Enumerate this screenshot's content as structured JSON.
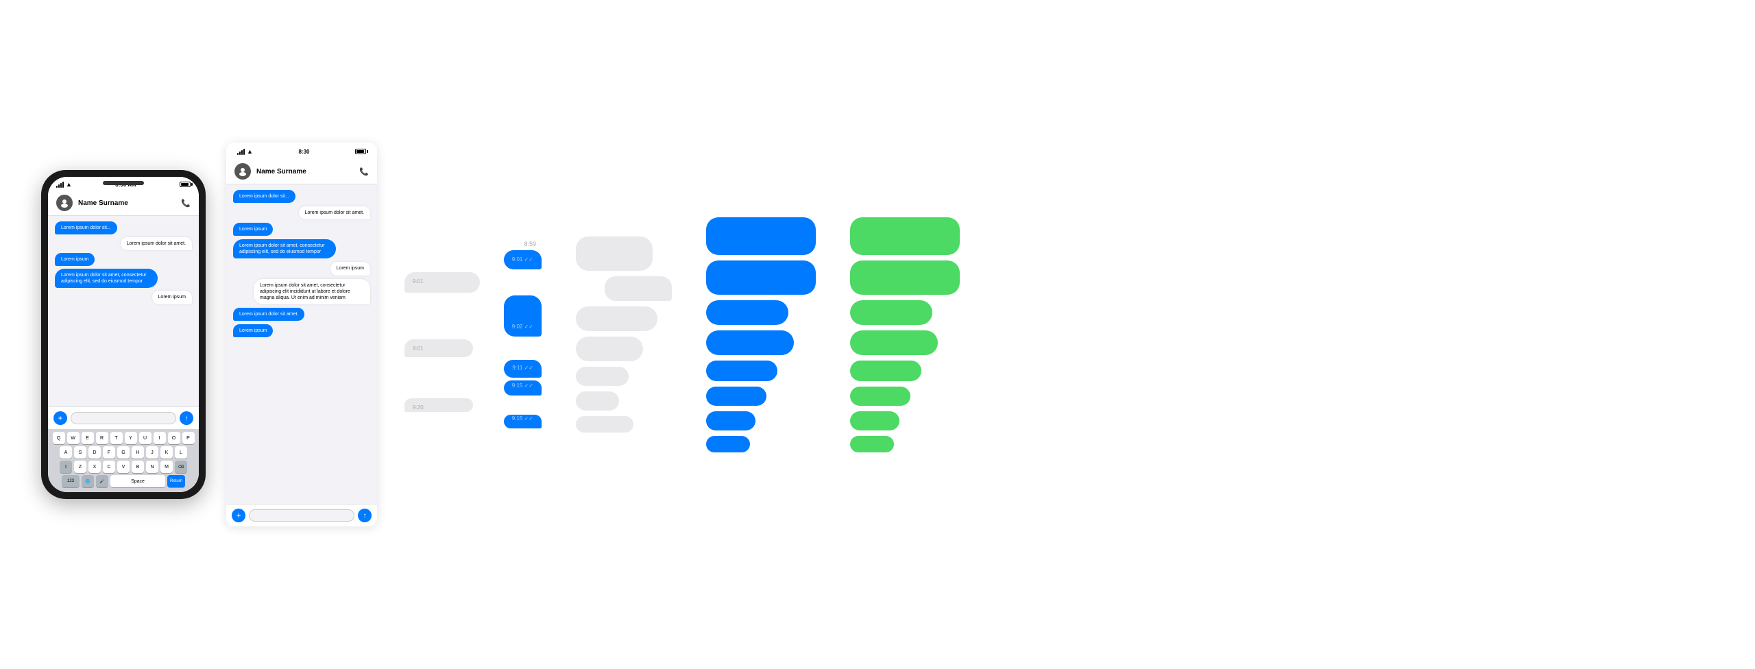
{
  "phone1": {
    "status_time": "8:30 AM",
    "contact_name": "Name Surname",
    "messages": [
      {
        "type": "sent",
        "text": "Lorem ipsum dolor sit..."
      },
      {
        "type": "received",
        "text": "Lorem ipsum dolor sit amet."
      },
      {
        "type": "sent",
        "text": "Lorem ipsum"
      },
      {
        "type": "sent",
        "text": "Lorem ipsum dolor sit amet, consectetur adipiscing elit, sed do eiusmod tempor"
      },
      {
        "type": "received",
        "text": "Lorem ipsum"
      }
    ],
    "input_placeholder": ""
  },
  "phone2": {
    "status_time": "8:30",
    "contact_name": "Name Surname",
    "messages": [
      {
        "type": "sent",
        "text": "Lorem ipsum dolor sit..."
      },
      {
        "type": "received",
        "text": "Lorem ipsum dolor sit amet."
      },
      {
        "type": "sent",
        "text": "Lorem ipsum"
      },
      {
        "type": "sent",
        "text": "Lorem ipsum dolor sit amet, consectetur adipiscing elit, sed do eiusmod tempor"
      },
      {
        "type": "received",
        "text": "Lorem ipsum"
      },
      {
        "type": "received",
        "text": "Lorem ipsum dolor sit amet, consectetur adipiscing elit incididunt ut labore et dolore magna aliqua. Ut enim ad minim veniam"
      },
      {
        "type": "sent",
        "text": "Lorem ipsum dolor sit amet."
      },
      {
        "type": "sent",
        "text": "Lorem ipsum"
      }
    ]
  },
  "timestamps": {
    "t1": "8:59",
    "t2": "9:01 ✓✓",
    "t3": "9:01",
    "t4": "9:02 ✓✓",
    "t5": "9:01",
    "t6": "9:11 ✓✓",
    "t7": "9:15 ✓✓",
    "t8": "9:20",
    "t9": "9:15 ✓✓"
  },
  "colors": {
    "blue": "#007AFF",
    "green": "#4CD964",
    "gray": "#e9e9eb",
    "white": "#ffffff"
  }
}
